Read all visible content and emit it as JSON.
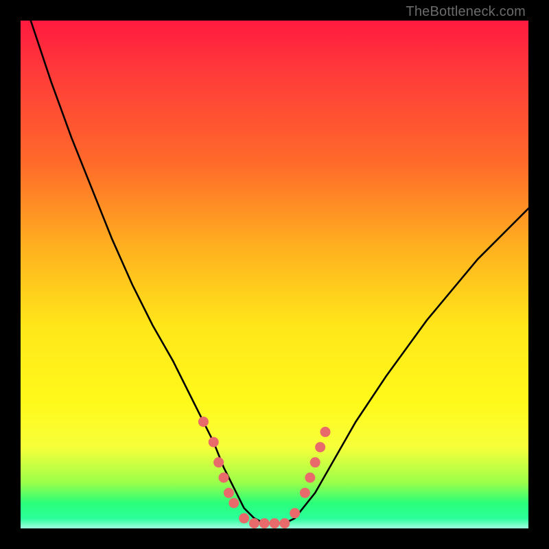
{
  "watermark": "TheBottleneck.com",
  "colors": {
    "frame_bg": "#000000",
    "gradient_top": "#ff1a3f",
    "gradient_mid": "#ffe61a",
    "gradient_green": "#2aff7a",
    "curve_stroke": "#000000",
    "marker_fill": "#e86a6a",
    "marker_edge": "#d85555"
  },
  "chart_data": {
    "type": "line",
    "title": "",
    "xlabel": "",
    "ylabel": "",
    "xlim": [
      0,
      100
    ],
    "ylim": [
      0,
      100
    ],
    "series": [
      {
        "name": "curve",
        "x": [
          2,
          6,
          10,
          14,
          18,
          22,
          26,
          30,
          34,
          36,
          38,
          40,
          42,
          44,
          46,
          48,
          50,
          52,
          54,
          58,
          62,
          66,
          72,
          80,
          90,
          100
        ],
        "y": [
          100,
          88,
          77,
          67,
          57,
          48,
          40,
          33,
          25,
          21,
          17,
          12,
          8,
          4,
          2,
          1,
          1,
          1,
          2,
          7,
          14,
          21,
          30,
          41,
          53,
          63
        ],
        "note": "y is percent height from bottom; visually this is a V-shaped valley curve"
      }
    ],
    "markers": {
      "name": "highlight-dots",
      "color": "#e86a6a",
      "points": [
        {
          "x": 36,
          "y": 21
        },
        {
          "x": 38,
          "y": 17
        },
        {
          "x": 39,
          "y": 13
        },
        {
          "x": 40,
          "y": 10
        },
        {
          "x": 41,
          "y": 7
        },
        {
          "x": 42,
          "y": 5
        },
        {
          "x": 44,
          "y": 2
        },
        {
          "x": 46,
          "y": 1
        },
        {
          "x": 48,
          "y": 1
        },
        {
          "x": 50,
          "y": 1
        },
        {
          "x": 52,
          "y": 1
        },
        {
          "x": 54,
          "y": 3
        },
        {
          "x": 56,
          "y": 7
        },
        {
          "x": 57,
          "y": 10
        },
        {
          "x": 58,
          "y": 13
        },
        {
          "x": 59,
          "y": 16
        },
        {
          "x": 60,
          "y": 19
        }
      ]
    }
  }
}
